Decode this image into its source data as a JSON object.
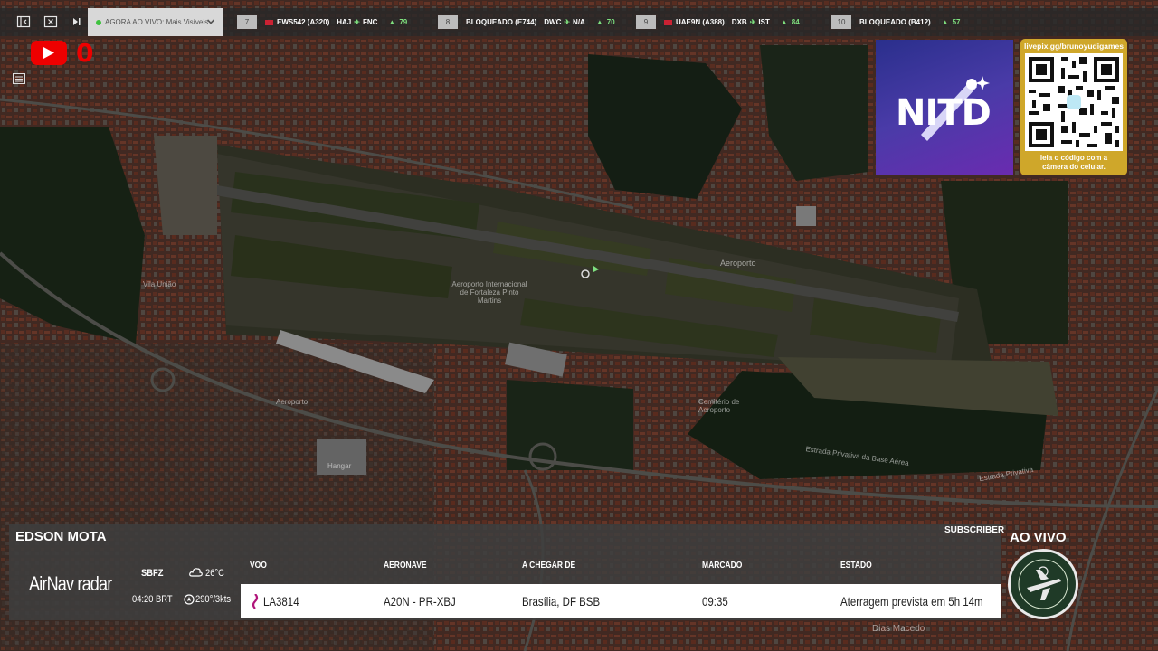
{
  "topbar": {
    "live_select_label": "AGORA AO VIVO: Mais Visíveis",
    "flights": [
      {
        "num": "7",
        "callsign": "EWS542 (A320)",
        "from": "HAJ",
        "to": "FNC",
        "count": "79"
      },
      {
        "num": "8",
        "callsign": "BLOQUEADO (E744)",
        "from": "DWC",
        "to": "N/A",
        "count": "70"
      },
      {
        "num": "9",
        "callsign": "UAE9N (A388)",
        "from": "DXB",
        "to": "IST",
        "count": "84"
      },
      {
        "num": "10",
        "callsign": "BLOQUEADO (B412)",
        "from": "",
        "to": "",
        "count": "57"
      }
    ]
  },
  "youtube": {
    "count": "0"
  },
  "map_labels": {
    "aeroporto_top": "Aeroporto",
    "airport_name": "Aeroporto Internacional de Fortaleza Pinto Martins",
    "hangar": "Hangar",
    "cemetery": "Cemitério de Aeroporto",
    "street_bottom": "Estrada Privativa da Base Aérea",
    "street_right": "Estrada Privativa",
    "dias_macedo": "Dias Macedo",
    "vila_uniao": "Vila União",
    "aeroporto_left": "Aeroporto"
  },
  "logos": {
    "nitd": "NITD",
    "qr_url": "livepix.gg/brunoyudigames",
    "qr_caption_1": "leia o código com a",
    "qr_caption_2": "câmera do celular."
  },
  "panel": {
    "streamer": "EDSON MOTA",
    "subscriber": "SUBSCRIBER",
    "brand_bold": "AirNav",
    "brand_light": " radar",
    "airport_code": "SBFZ",
    "local_time": "04:20 BRT",
    "temperature": "26°C",
    "wind": "290°/3kts",
    "columns": {
      "voo": "VOO",
      "aeronave": "AERONAVE",
      "chegar": "A CHEGAR DE",
      "marcado": "MARCADO",
      "estado": "ESTADO"
    },
    "row": {
      "voo": "LA3814",
      "aeronave": "A20N - PR-XBJ",
      "chegar": "Brasília, DF BSB",
      "marcado": "09:35",
      "estado": "Aterragem prevista em 5h 14m"
    },
    "ao_vivo": "AO VIVO"
  },
  "colors": {
    "accent_green": "#7fe07f",
    "youtube_red": "#ee0000",
    "qr_gold": "#cfa72a"
  }
}
